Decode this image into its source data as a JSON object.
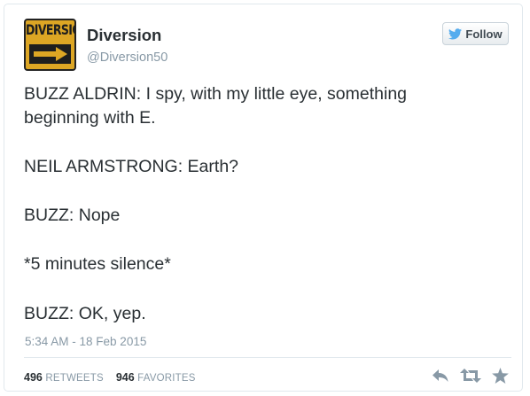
{
  "user": {
    "name": "Diversion",
    "handle": "@Diversion50",
    "avatar_text": "DIVERSION"
  },
  "follow_button": {
    "label": "Follow",
    "icon": "twitter-bird-icon"
  },
  "tweet": {
    "lines": [
      "BUZZ ALDRIN: I spy, with my little eye, something",
      "beginning with E.",
      "NEIL ARMSTRONG: Earth?",
      "BUZZ: Nope",
      "*5 minutes silence*",
      "BUZZ: OK, yep."
    ],
    "timestamp": "5:34 AM - 18 Feb 2015"
  },
  "stats": {
    "retweets_count": "496",
    "retweets_label": "RETWEETS",
    "favorites_count": "946",
    "favorites_label": "FAVORITES"
  },
  "actions": [
    "reply-icon",
    "retweet-icon",
    "favorite-star-icon"
  ],
  "colors": {
    "text": "#292f33",
    "muted": "#8899a6",
    "border": "#e1e8ed",
    "twitter_blue": "#55acee",
    "avatar_gold": "#dda624",
    "action_gray": "#8899a6"
  }
}
